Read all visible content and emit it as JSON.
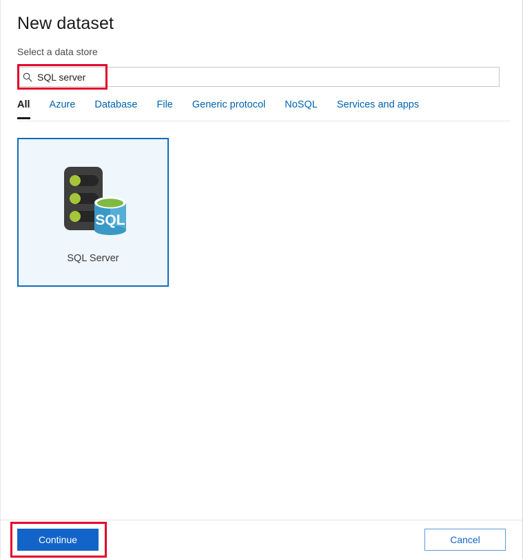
{
  "dialog": {
    "title": "New dataset",
    "section_label": "Select a data store"
  },
  "search": {
    "icon": "search-icon",
    "value": "SQL server",
    "placeholder": "Search"
  },
  "tabs": [
    {
      "label": "All",
      "active": true
    },
    {
      "label": "Azure",
      "active": false
    },
    {
      "label": "Database",
      "active": false
    },
    {
      "label": "File",
      "active": false
    },
    {
      "label": "Generic protocol",
      "active": false
    },
    {
      "label": "NoSQL",
      "active": false
    },
    {
      "label": "Services and apps",
      "active": false
    }
  ],
  "results": [
    {
      "label": "SQL Server",
      "icon": "sql-server-icon",
      "selected": true
    }
  ],
  "footer": {
    "continue_label": "Continue",
    "cancel_label": "Cancel"
  },
  "colors": {
    "accent": "#0f6cbd",
    "primary_button": "#1264c8",
    "link": "#0063b1",
    "highlight": "#e3002b",
    "card_selected_bg": "#eff6fc",
    "icon_server_dark": "#3e3e3e",
    "icon_server_slot": "#262626",
    "icon_led_green": "#a4c639",
    "icon_db_blue": "#3999c6",
    "icon_db_green": "#7fba42"
  }
}
